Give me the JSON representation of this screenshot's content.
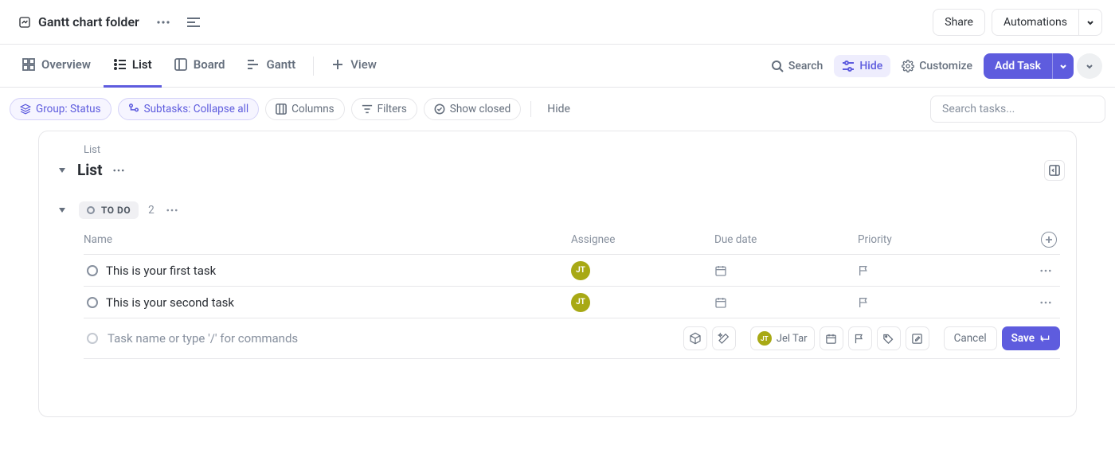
{
  "header": {
    "folder_title": "Gantt chart folder",
    "share": "Share",
    "automations": "Automations"
  },
  "views": {
    "tabs": [
      {
        "label": "Overview"
      },
      {
        "label": "List"
      },
      {
        "label": "Board"
      },
      {
        "label": "Gantt"
      },
      {
        "label": "View"
      }
    ],
    "search": "Search",
    "hide": "Hide",
    "customize": "Customize",
    "add_task": "Add Task"
  },
  "filters": {
    "group": "Group: Status",
    "subtasks": "Subtasks: Collapse all",
    "columns": "Columns",
    "filters": "Filters",
    "show_closed": "Show closed",
    "hide": "Hide",
    "search_placeholder": "Search tasks..."
  },
  "list": {
    "breadcrumb": "List",
    "title": "List",
    "group": {
      "status": "TO DO",
      "count": "2"
    },
    "columns": {
      "name": "Name",
      "assignee": "Assignee",
      "due": "Due date",
      "priority": "Priority"
    },
    "rows": [
      {
        "name": "This is your first task",
        "initials": "JT"
      },
      {
        "name": "This is your second task",
        "initials": "JT"
      }
    ],
    "new_task": {
      "placeholder": "Task name or type '/' for commands",
      "assignee_initials": "JT",
      "assignee_label": "Jel Tar",
      "cancel": "Cancel",
      "save": "Save"
    }
  }
}
